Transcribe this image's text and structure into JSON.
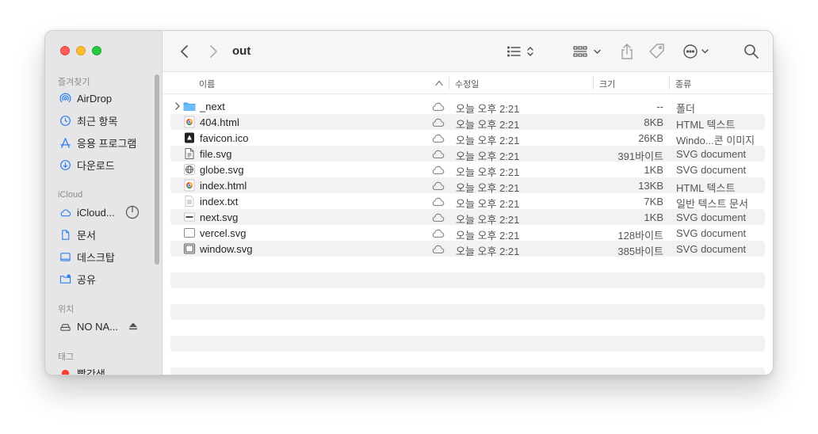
{
  "window": {
    "title": "out"
  },
  "sidebar": {
    "favorites_header": "즐겨찾기",
    "favorites": [
      {
        "label": "AirDrop",
        "icon": "airdrop-icon"
      },
      {
        "label": "최근 항목",
        "icon": "recents-clock-icon"
      },
      {
        "label": "응용 프로그램",
        "icon": "applications-icon"
      },
      {
        "label": "다운로드",
        "icon": "downloads-icon"
      }
    ],
    "icloud_header": "iCloud",
    "icloud": [
      {
        "label": "iCloud...",
        "icon": "icloud-icon"
      },
      {
        "label": "문서",
        "icon": "document-icon"
      },
      {
        "label": "데스크탑",
        "icon": "desktop-icon"
      },
      {
        "label": "공유",
        "icon": "shared-folder-icon"
      }
    ],
    "locations_header": "위치",
    "locations": [
      {
        "label": "NO NA...",
        "icon": "drive-icon"
      }
    ],
    "tags_header": "태그",
    "tags": [
      {
        "label": "빨간색",
        "color": "#ff3b30"
      }
    ]
  },
  "columns": {
    "name": "이름",
    "date": "수정일",
    "size": "크기",
    "kind": "종류"
  },
  "files": [
    {
      "name": "_next",
      "date": "오늘 오후 2:21",
      "size": "--",
      "kind": "폴더",
      "icon": "folder-icon",
      "expandable": true
    },
    {
      "name": "404.html",
      "date": "오늘 오후 2:21",
      "size": "8KB",
      "kind": "HTML 텍스트",
      "icon": "chrome-html-icon"
    },
    {
      "name": "favicon.ico",
      "date": "오늘 오후 2:21",
      "size": "26KB",
      "kind": "Windo...콘 이미지",
      "icon": "ico-file-icon"
    },
    {
      "name": "file.svg",
      "date": "오늘 오후 2:21",
      "size": "391바이트",
      "kind": "SVG document",
      "icon": "svg-file-icon"
    },
    {
      "name": "globe.svg",
      "date": "오늘 오후 2:21",
      "size": "1KB",
      "kind": "SVG document",
      "icon": "globe-svg-icon"
    },
    {
      "name": "index.html",
      "date": "오늘 오후 2:21",
      "size": "13KB",
      "kind": "HTML 텍스트",
      "icon": "chrome-html-icon"
    },
    {
      "name": "index.txt",
      "date": "오늘 오후 2:21",
      "size": "7KB",
      "kind": "일반 텍스트 문서",
      "icon": "text-file-icon"
    },
    {
      "name": "next.svg",
      "date": "오늘 오후 2:21",
      "size": "1KB",
      "kind": "SVG document",
      "icon": "next-svg-icon"
    },
    {
      "name": "vercel.svg",
      "date": "오늘 오후 2:21",
      "size": "128바이트",
      "kind": "SVG document",
      "icon": "vercel-svg-icon"
    },
    {
      "name": "window.svg",
      "date": "오늘 오후 2:21",
      "size": "385바이트",
      "kind": "SVG document",
      "icon": "window-svg-icon"
    }
  ]
}
